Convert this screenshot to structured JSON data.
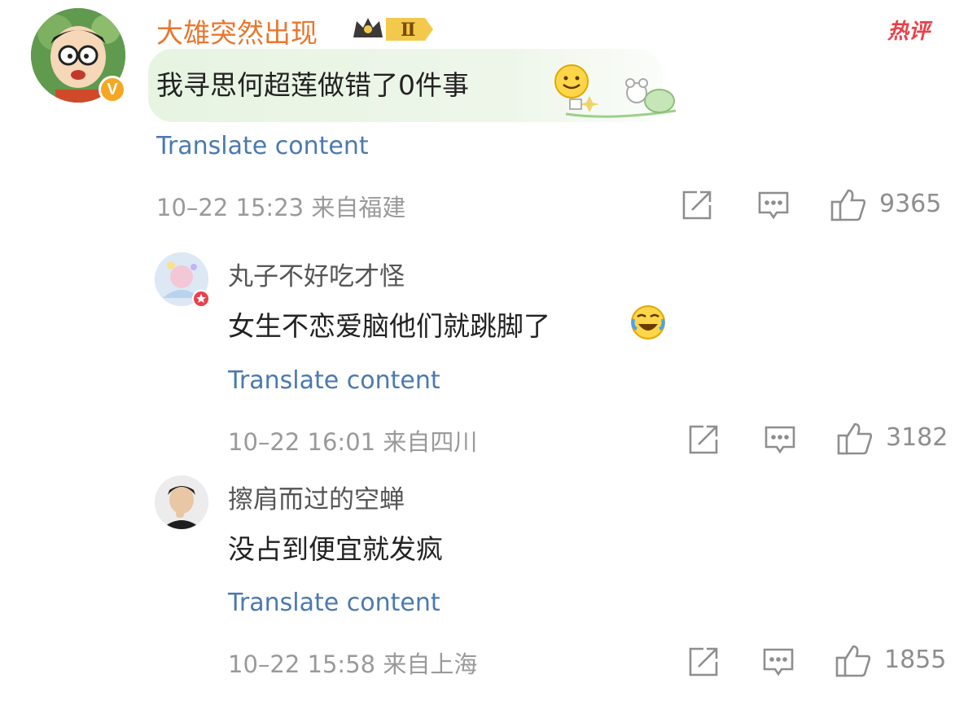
{
  "comments": [
    {
      "username": "大雄突然出现",
      "text": "我寻思何超莲做错了0件事",
      "translate": "Translate content",
      "meta": "10–22 15:23 来自福建",
      "likes": "9365",
      "badge": "Ⅱ",
      "hot_label": "热评",
      "verified": "V"
    },
    {
      "username": "丸子不好吃才怪",
      "text": "女生不恋爱脑他们就跳脚了",
      "translate": "Translate content",
      "meta": "10–22 16:01 来自四川",
      "likes": "3182"
    },
    {
      "username": "擦肩而过的空蝉",
      "text": "没占到便宜就发疯",
      "translate": "Translate content",
      "meta": "10–22 15:58 来自上海",
      "likes": "1855"
    }
  ],
  "icons": [
    "share-icon",
    "comment-icon",
    "like-icon",
    "smile-emoji-icon",
    "laugh-cry-emoji-icon",
    "crown-badge-icon"
  ],
  "colors": {
    "username_accent": "#e8772e",
    "link": "#4b79b0",
    "hot": "#e8414b",
    "bubble": "#e7f4e2"
  }
}
